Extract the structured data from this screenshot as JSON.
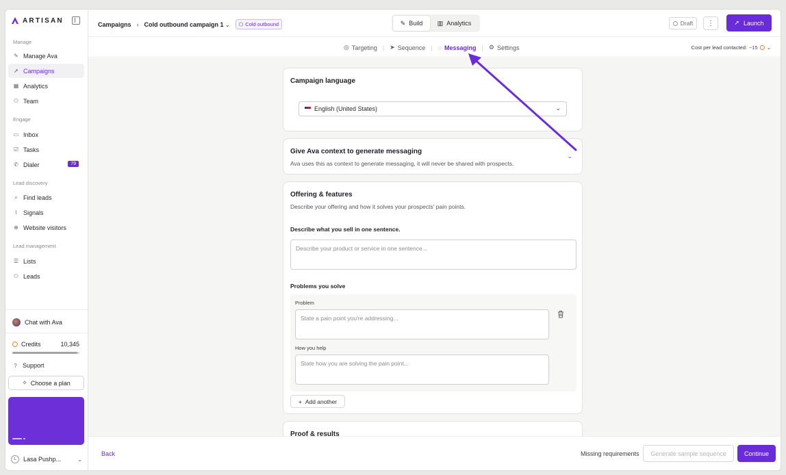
{
  "brand": {
    "name": "ARTISAN",
    "accent": "#6a2bd8"
  },
  "sidebar": {
    "sections": [
      {
        "label": "Manage",
        "items": [
          {
            "label": "Manage Ava",
            "icon": "wand-icon"
          },
          {
            "label": "Campaigns",
            "icon": "rocket-icon",
            "active": true
          },
          {
            "label": "Analytics",
            "icon": "chart-icon"
          },
          {
            "label": "Team",
            "icon": "user-icon"
          }
        ]
      },
      {
        "label": "Engage",
        "items": [
          {
            "label": "Inbox",
            "icon": "inbox-icon"
          },
          {
            "label": "Tasks",
            "icon": "tasks-icon"
          },
          {
            "label": "Dialer",
            "icon": "phone-icon",
            "badge": "79"
          }
        ]
      },
      {
        "label": "Lead discovery",
        "items": [
          {
            "label": "Find leads",
            "icon": "find-leads-icon"
          },
          {
            "label": "Signals",
            "icon": "signal-icon"
          },
          {
            "label": "Website visitors",
            "icon": "globe-icon"
          }
        ]
      },
      {
        "label": "Lead management",
        "items": [
          {
            "label": "Lists",
            "icon": "list-icon"
          },
          {
            "label": "Leads",
            "icon": "users-icon"
          }
        ]
      }
    ],
    "chat_label": "Chat with Ava",
    "credits_label": "Credits",
    "credits_value": "10,345",
    "credits_fraction": 0.97,
    "support_label": "Support",
    "plan_button": "Choose a plan",
    "user_initial": "L",
    "user_name": "Lasa Pushp..."
  },
  "header": {
    "crumb_root": "Campaigns",
    "campaign_name": "Cold outbound campaign 1",
    "campaign_tag": "Cold outbound",
    "mode_tabs": [
      {
        "label": "Build",
        "active": true
      },
      {
        "label": "Analytics",
        "active": false
      }
    ],
    "status": "Draft",
    "launch_label": "Launch"
  },
  "subnav": {
    "tabs": [
      {
        "label": "Targeting",
        "icon": "target-icon"
      },
      {
        "label": "Sequence",
        "icon": "send-icon"
      },
      {
        "label": "Messaging",
        "icon": "message-icon",
        "active": true
      },
      {
        "label": "Settings",
        "icon": "settings-icon"
      }
    ],
    "cost_label": "Cost per lead contacted:",
    "cost_value": "~15"
  },
  "language_card": {
    "title": "Campaign language",
    "selected": "English (United States)"
  },
  "context_card": {
    "title": "Give Ava context to generate messaging",
    "description": "Ava uses this as context to generate messaging, it will never be shared with prospects."
  },
  "offering_card": {
    "title": "Offering & features",
    "description": "Describe your offering and how it solves your prospects' pain points.",
    "sell_label": "Describe what you sell in one sentence.",
    "sell_placeholder": "Describe your product or service in one sentence...",
    "problems_label": "Problems you solve",
    "problem_label": "Problem",
    "problem_placeholder": "State a pain point you're addressing...",
    "help_label": "How you help",
    "help_placeholder": "State how you are solving the pain point...",
    "add_another": "Add another"
  },
  "proof_card": {
    "title": "Proof & results"
  },
  "footer": {
    "back": "Back",
    "missing": "Missing requirements",
    "generate": "Generate sample sequence",
    "continue": "Continue"
  }
}
